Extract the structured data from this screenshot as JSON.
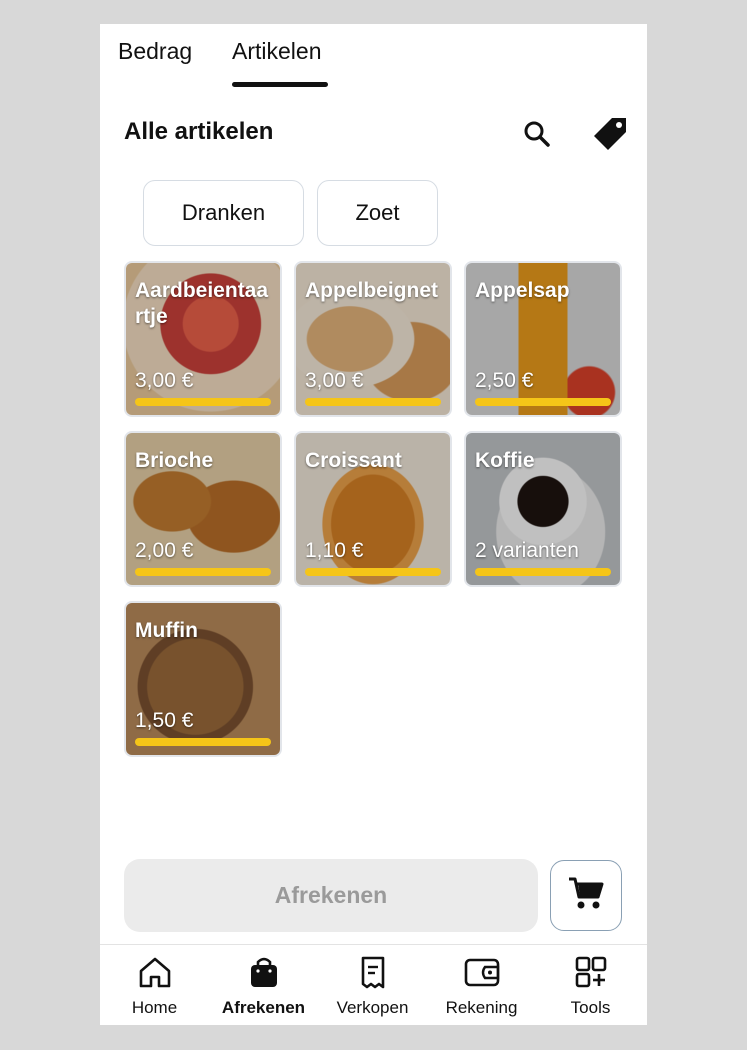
{
  "tabs": {
    "bedrag": "Bedrag",
    "artikelen": "Artikelen",
    "active": "Artikelen"
  },
  "header": {
    "title": "Alle artikelen",
    "search_icon": "search-icon",
    "tag_icon": "tag-icon"
  },
  "categories": [
    {
      "label": "Dranken"
    },
    {
      "label": "Zoet"
    }
  ],
  "products": [
    {
      "name": "Aardbeientaartje",
      "price": "3,00 €",
      "image": "strawberry-tart",
      "color": "#e05a3a"
    },
    {
      "name": "Appelbeignet",
      "price": "3,00 €",
      "image": "apple-beignet",
      "color": "#d9a45c"
    },
    {
      "name": "Appelsap",
      "price": "2,50 €",
      "image": "apple-juice",
      "color": "#e8a020"
    },
    {
      "name": "Brioche",
      "price": "2,00 €",
      "image": "brioche",
      "color": "#c98a3a"
    },
    {
      "name": "Croissant",
      "price": "1,10 €",
      "image": "croissant",
      "color": "#d68a2e"
    },
    {
      "name": "Koffie",
      "price": "2 varianten",
      "image": "coffee",
      "color": "#3a2a20"
    },
    {
      "name": "Muffin",
      "price": "1,50 €",
      "image": "muffin",
      "color": "#9a6a3a"
    }
  ],
  "accent_bar_color": "#f5c518",
  "checkout": {
    "label": "Afrekenen",
    "cart_icon": "cart-icon"
  },
  "nav": [
    {
      "label": "Home",
      "icon": "home-icon",
      "active": false
    },
    {
      "label": "Afrekenen",
      "icon": "shopping-bag-icon",
      "active": true
    },
    {
      "label": "Verkopen",
      "icon": "receipt-icon",
      "active": false
    },
    {
      "label": "Rekening",
      "icon": "wallet-icon",
      "active": false
    },
    {
      "label": "Tools",
      "icon": "grid-plus-icon",
      "active": false
    }
  ]
}
